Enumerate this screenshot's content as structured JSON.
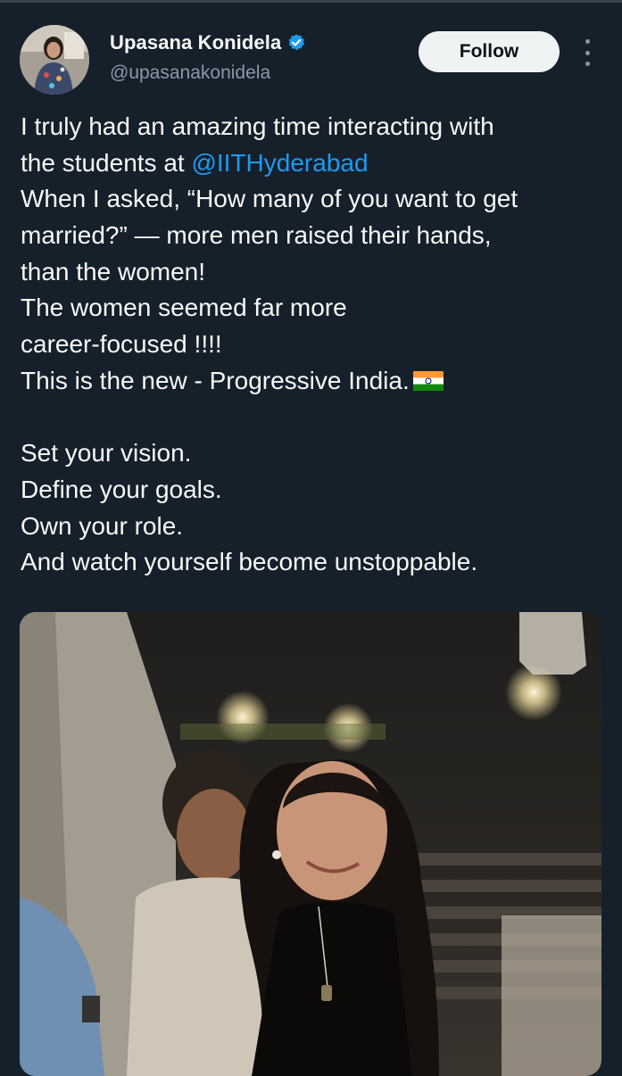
{
  "tweet": {
    "author": {
      "display_name": "Upasana Konidela",
      "handle": "@upasanakonidela",
      "verified": true,
      "verified_color": "#1d9bf0"
    },
    "follow_label": "Follow",
    "text": {
      "line1": "I truly had an amazing time interacting with",
      "line2_prefix": "the students at ",
      "line2_mention": "@IITHyderabad",
      "line3": "When I asked, “How many of you want to get",
      "line4": "married?” — more men raised their hands,",
      "line5": "than the women!",
      "line6": "The women seemed far more",
      "line7": "career-focused !!!!",
      "line8": "This is the new - Progressive India.",
      "line9": "Set your vision.",
      "line10": "Define your goals.",
      "line11": "Own your role.",
      "line12": "And watch yourself become unstoppable."
    },
    "emoji": "india-flag",
    "media": {
      "type": "video-still",
      "description_icon": "photo"
    }
  },
  "colors": {
    "background": "#15202b",
    "text_primary": "#f7f9f9",
    "text_secondary": "#8b98a5",
    "link": "#1d9bf0",
    "follow_button_bg": "#eff3f4",
    "follow_button_text": "#0f1419"
  }
}
